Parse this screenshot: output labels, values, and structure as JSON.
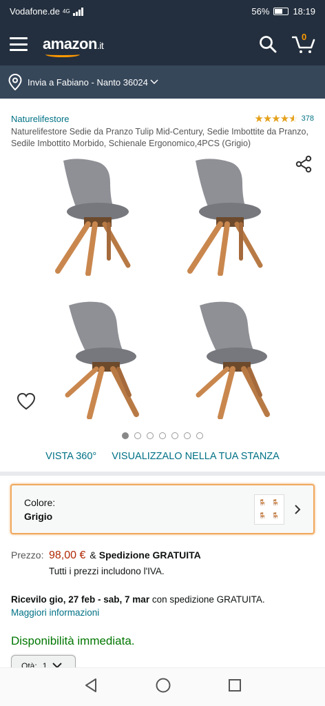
{
  "status_bar": {
    "carrier": "Vodafone.de",
    "network": "4G",
    "battery": "56%",
    "time": "18:19"
  },
  "nav": {
    "logo_text": "amazon",
    "logo_tld": ".it",
    "cart_count": "0",
    "deliver_to": "Invia a Fabiano - Nanto 36024"
  },
  "product": {
    "brand": "Naturelifestore",
    "rating_count": "378",
    "rating_stars": 4.5,
    "title": "Naturelifestore Sedie da Pranzo Tulip Mid-Century, Sedie Imbottite da Pranzo, Sedile Imbottito Morbido, Schienale Ergonomico,4PCS (Grigio)"
  },
  "gallery": {
    "dot_count": 7,
    "active_dot": 0
  },
  "view_links": {
    "view360": "VISTA 360°",
    "view_room": "VISUALIZZALO NELLA TUA STANZA"
  },
  "color": {
    "label": "Colore:",
    "value": "Grigio"
  },
  "pricing": {
    "label": "Prezzo:",
    "price": "98,00 €",
    "amp": "&",
    "shipping": "Spedizione GRATUITA",
    "iva_note": "Tutti i prezzi includono l'IVA."
  },
  "delivery": {
    "prefix": "Ricevilo gio, 27 feb - sab, 7 mar",
    "suffix": " con spedizione GRATUITA.",
    "more_info": "Maggiori informazioni"
  },
  "availability": "Disponibilità immediata.",
  "quantity": {
    "label": "Qtà:",
    "value": "1"
  },
  "colors": {
    "header_bg": "#232f3e",
    "subheader_bg": "#37475a",
    "link": "#007185",
    "price": "#b12704",
    "in_stock": "#007600",
    "accent": "#ff9900"
  }
}
